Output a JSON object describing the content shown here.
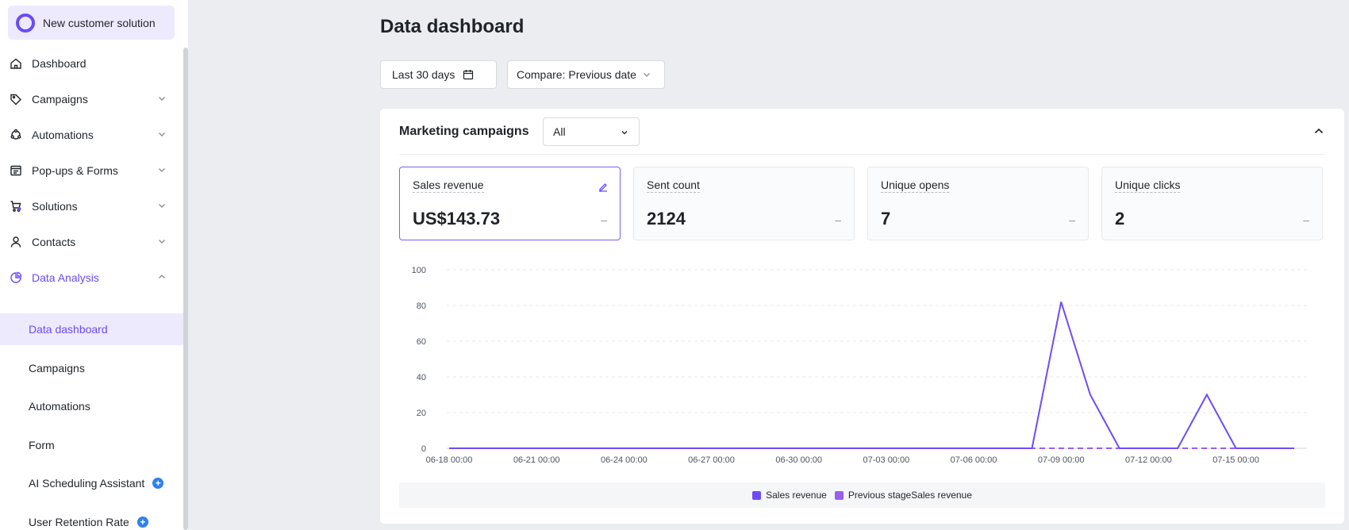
{
  "brand": {
    "label": "New customer solution"
  },
  "sidebar": {
    "items": [
      {
        "label": "Dashboard",
        "icon": "home-icon",
        "chevron": false
      },
      {
        "label": "Campaigns",
        "icon": "tag-icon",
        "chevron": true
      },
      {
        "label": "Automations",
        "icon": "automation-icon",
        "chevron": true
      },
      {
        "label": "Pop-ups & Forms",
        "icon": "form-icon",
        "chevron": true
      },
      {
        "label": "Solutions",
        "icon": "cart-icon",
        "chevron": true
      },
      {
        "label": "Contacts",
        "icon": "user-icon",
        "chevron": true
      },
      {
        "label": "Data Analysis",
        "icon": "pie-chart-icon",
        "chevron": true,
        "expanded": true
      }
    ],
    "sub_items": [
      {
        "label": "Data dashboard",
        "active": true
      },
      {
        "label": "Campaigns"
      },
      {
        "label": "Automations"
      },
      {
        "label": "Form"
      },
      {
        "label": "AI Scheduling Assistant",
        "plus": true
      },
      {
        "label": "User Retention Rate",
        "plus": true
      }
    ]
  },
  "main": {
    "title": "Data dashboard",
    "date_range": "Last 30 days",
    "compare": "Compare: Previous date"
  },
  "card": {
    "title": "Marketing campaigns",
    "filter": "All",
    "metrics": [
      {
        "label": "Sales revenue",
        "value": "US$143.73",
        "change": "–",
        "selected": true
      },
      {
        "label": "Sent count",
        "value": "2124",
        "change": "–"
      },
      {
        "label": "Unique opens",
        "value": "7",
        "change": "–"
      },
      {
        "label": "Unique clicks",
        "value": "2",
        "change": "–"
      }
    ]
  },
  "colors": {
    "accent": "#6a4cf5",
    "series1": "#6f4cf6",
    "series2": "#9b5ef0"
  },
  "chart_data": {
    "type": "line",
    "x_ticks": [
      "06-18 00:00",
      "06-21 00:00",
      "06-24 00:00",
      "06-27 00:00",
      "06-30 00:00",
      "07-03 00:00",
      "07-06 00:00",
      "07-09 00:00",
      "07-12 00:00",
      "07-15 00:00"
    ],
    "y_ticks": [
      0,
      20,
      40,
      60,
      80,
      100
    ],
    "ylim": [
      0,
      100
    ],
    "x": [
      "06-18",
      "06-19",
      "06-20",
      "06-21",
      "06-22",
      "06-23",
      "06-24",
      "06-25",
      "06-26",
      "06-27",
      "06-28",
      "06-29",
      "06-30",
      "07-01",
      "07-02",
      "07-03",
      "07-04",
      "07-05",
      "07-06",
      "07-07",
      "07-08",
      "07-09",
      "07-10",
      "07-11",
      "07-12",
      "07-13",
      "07-14",
      "07-15",
      "07-16",
      "07-17"
    ],
    "series": [
      {
        "name": "Sales revenue",
        "values": [
          0,
          0,
          0,
          0,
          0,
          0,
          0,
          0,
          0,
          0,
          0,
          0,
          0,
          0,
          0,
          0,
          0,
          0,
          0,
          0,
          0,
          82,
          30,
          0,
          0,
          0,
          30,
          0,
          0,
          0
        ]
      },
      {
        "name": "Previous stageSales revenue",
        "values": [
          0,
          0,
          0,
          0,
          0,
          0,
          0,
          0,
          0,
          0,
          0,
          0,
          0,
          0,
          0,
          0,
          0,
          0,
          0,
          0,
          0,
          0,
          0,
          0,
          0,
          0,
          0,
          0,
          0,
          0
        ]
      }
    ],
    "grid": true,
    "legend": "bottom"
  }
}
